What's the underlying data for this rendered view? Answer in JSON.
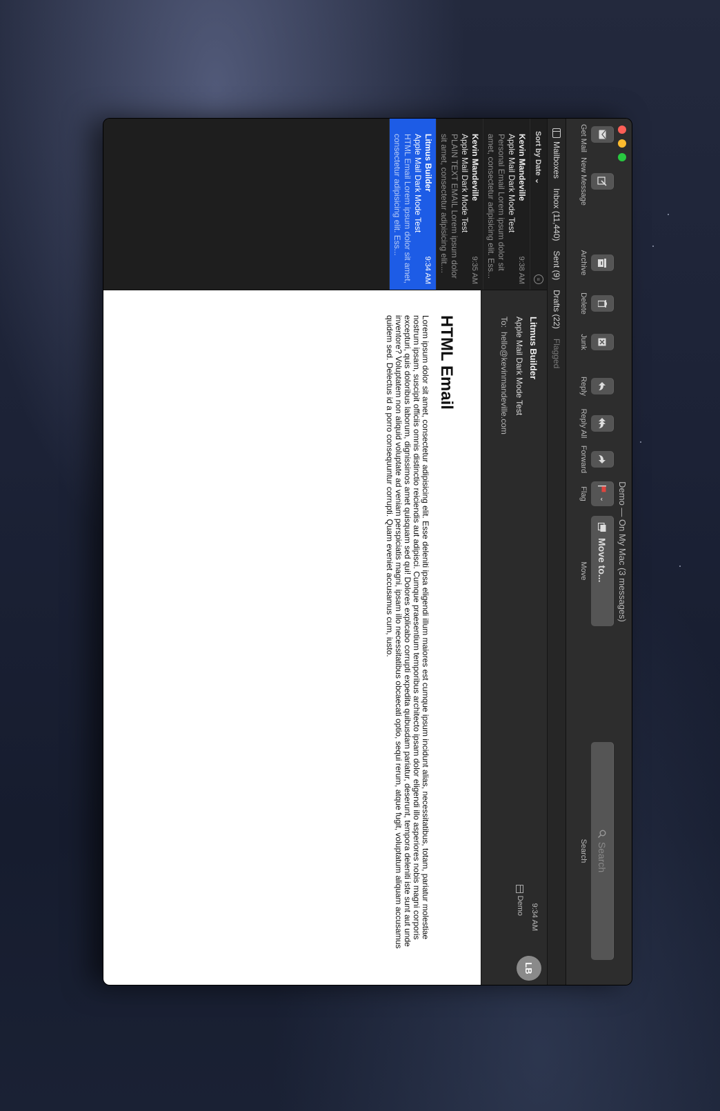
{
  "window": {
    "title": "Demo — On My Mac (3 messages)"
  },
  "toolbar": {
    "get_mail": "Get Mail",
    "new_message": "New Message",
    "archive": "Archive",
    "delete": "Delete",
    "junk": "Junk",
    "reply": "Reply",
    "reply_all": "Reply All",
    "forward": "Forward",
    "flag": "Flag",
    "move_to": "Move to...",
    "move": "Move",
    "search_placeholder": "Search",
    "search": "Search"
  },
  "favorites": {
    "mailboxes": "Mailboxes",
    "inbox": "Inbox (11,440)",
    "sent": "Sent (9)",
    "drafts": "Drafts (22)",
    "flagged": "Flagged"
  },
  "list": {
    "sort_label": "Sort by Date",
    "messages": [
      {
        "from": "Kevin Mandeville",
        "time": "9:38 AM",
        "subject": "Apple Mail Dark Mode Test",
        "preview": "Personal Email Lorem ipsum dolor sit amet, consectetur adipisicing elit. Ess..."
      },
      {
        "from": "Kevin Mandeville",
        "time": "9:35 AM",
        "subject": "Apple Mail Dark Mode Test",
        "preview": "PLAIN TEXT EMAIL Lorem ipsum dolor sit amet, consectetur adipisicing elit...."
      },
      {
        "from": "Litmus Builder",
        "time": "9:34 AM",
        "subject": "Apple Mail Dark Mode Test",
        "preview": "HTML Email Lorem ipsum dolor sit amet, consectetur adipisicing elit. Ess..."
      }
    ]
  },
  "reader": {
    "from": "Litmus Builder",
    "subject": "Apple Mail Dark Mode Test",
    "to_label": "To:",
    "to": "hello@kevinmandeville.com",
    "mailbox": "Demo",
    "time": "9:34 AM",
    "avatar": "LB",
    "heading": "HTML Email",
    "body": "Lorem ipsum dolor sit amet, consectetur adipisicing elit. Esse deleniti ipsa eligendi illum maiores est cumque ipsum incidunt alias, necessitatibus, totam, pariatur molestiae nostrum ipsam, suscipit officiis omnis distinctio reiciendis aut adipisci. Cumque praesentium temporibus architecto ipsam dolor eligendi illo asperiores nobis magni corporis excepturi, quis doloribus laborum, dignissimos amet quisquam sed qui! Dolores explicabo corrupti expedita quibusdam pariatur, deserunt, tempora deleniti iste sunt aut unde inventore? Voluptatem non aliquid voluptate ad veniam perspiciatis magni, ipsam illo necessitatibus obcaecati optio, sequi rerum, atque fugit, voluptatum aliquam accusamus quidem sed. Delectus id a porro consequuntur corrupti. Quam eveniet accusamus cum, iusto."
  },
  "colors": {
    "selection": "#1d5ce6",
    "flag": "#e0443e"
  }
}
